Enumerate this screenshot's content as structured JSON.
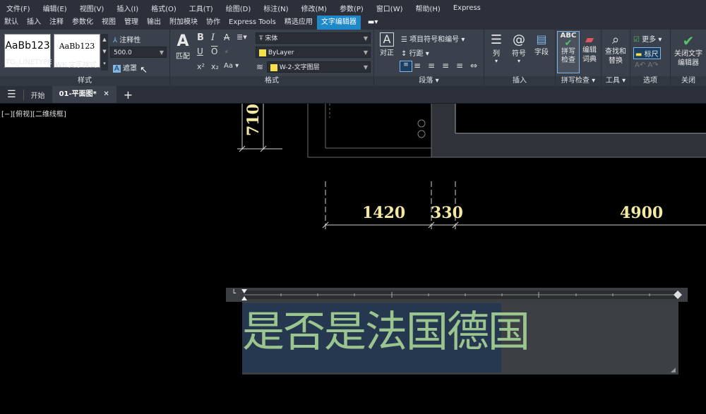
{
  "menubar": [
    "文件(F)",
    "编辑(E)",
    "视图(V)",
    "插入(I)",
    "格式(O)",
    "工具(T)",
    "绘图(D)",
    "标注(N)",
    "修改(M)",
    "参数(P)",
    "窗口(W)",
    "帮助(H)",
    "Express"
  ],
  "ribbon_tabs": [
    "默认",
    "插入",
    "注释",
    "参数化",
    "视图",
    "管理",
    "输出",
    "附加模块",
    "协作",
    "Express Tools",
    "精选应用",
    "文字编辑器"
  ],
  "active_tab": "文字编辑器",
  "style_panel": {
    "swatch1": "AaBb123",
    "swatch1_name": "TG_LINETYPE",
    "swatch2": "AaBb123",
    "swatch2_name": "WK-文字样式",
    "annotative": "注释性",
    "height": "500.0",
    "mask": "遮罩",
    "title": "样式"
  },
  "format_panel": {
    "match": "匹配",
    "font": "宋体",
    "color": "ByLayer",
    "layer": "W-2-文字图层",
    "title": "格式"
  },
  "paragraph_panel": {
    "justify": "对正",
    "bullets": "项目符号和编号",
    "spacing": "行距",
    "title": "段落"
  },
  "insert_panel": {
    "column": "列",
    "symbol": "符号",
    "field": "字段",
    "title": "插入"
  },
  "spell_panel": {
    "spell": "拼写检查",
    "dictionary": "编辑词典",
    "title": "拼写检查"
  },
  "tools_panel": {
    "find": "查找和替换",
    "title": "工具"
  },
  "options_panel": {
    "more": "更多",
    "ruler": "标尺",
    "title": "选项"
  },
  "close_panel": {
    "close": "关闭文字编辑器",
    "title": "关闭"
  },
  "doc_tabs": {
    "start": "开始",
    "active": "01-平面图*"
  },
  "viewport_label": "[−][俯视][二维线框]",
  "dimensions": {
    "d710": "710",
    "d1420": "1420",
    "d330": "330",
    "d4900": "4900"
  },
  "editor_text": "是否是法国德国"
}
